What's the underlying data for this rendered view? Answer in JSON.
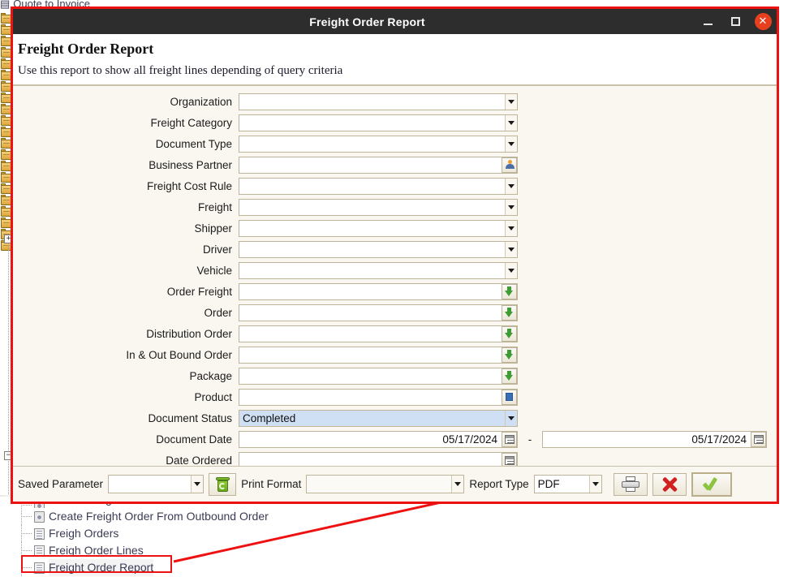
{
  "background": {
    "top_item_label": "Quote to Invoice",
    "tree_items": [
      {
        "label": "Create Freight Order From Order",
        "icon": "gear-icon",
        "selected": false,
        "clipped": true
      },
      {
        "label": "Create Freight Order From Outbound Order",
        "icon": "gear-icon",
        "selected": false,
        "clipped": false
      },
      {
        "label": "Freigh Orders",
        "icon": "document-icon",
        "selected": false,
        "clipped": false
      },
      {
        "label": "Freigh Order Lines",
        "icon": "document-icon",
        "selected": false,
        "clipped": false
      },
      {
        "label": "Freight Order Report",
        "icon": "document-icon",
        "selected": true,
        "clipped": false
      }
    ],
    "expanders": [
      {
        "name": "expander-plus",
        "glyph": "+"
      },
      {
        "name": "expander-minus",
        "glyph": "−"
      }
    ]
  },
  "dialog": {
    "titlebar": {
      "title": "Freight Order Report",
      "minimize_label": "–",
      "maximize_label": "□",
      "close_label": "✕"
    },
    "header": {
      "title": "Freight Order Report",
      "description": "Use this report to show all freight lines depending of query criteria"
    },
    "fields": [
      {
        "label": "Organization",
        "value": "",
        "control": "combo",
        "icon": "chevron-down-icon"
      },
      {
        "label": "Freight Category",
        "value": "",
        "control": "combo",
        "icon": "chevron-down-icon"
      },
      {
        "label": "Document Type",
        "value": "",
        "control": "combo",
        "icon": "chevron-down-icon"
      },
      {
        "label": "Business Partner",
        "value": "",
        "control": "button",
        "icon": "person-icon"
      },
      {
        "label": "Freight Cost Rule",
        "value": "",
        "control": "combo",
        "icon": "chevron-down-icon"
      },
      {
        "label": "Freight",
        "value": "",
        "control": "combo",
        "icon": "chevron-down-icon"
      },
      {
        "label": "Shipper",
        "value": "",
        "control": "combo",
        "icon": "chevron-down-icon"
      },
      {
        "label": "Driver",
        "value": "",
        "control": "combo",
        "icon": "chevron-down-icon"
      },
      {
        "label": "Vehicle",
        "value": "",
        "control": "combo",
        "icon": "chevron-down-icon"
      },
      {
        "label": "Order Freight",
        "value": "",
        "control": "button",
        "icon": "green-down-arrow-icon"
      },
      {
        "label": "Order",
        "value": "",
        "control": "button",
        "icon": "green-down-arrow-icon"
      },
      {
        "label": "Distribution Order",
        "value": "",
        "control": "button",
        "icon": "green-down-arrow-icon"
      },
      {
        "label": "In & Out Bound Order",
        "value": "",
        "control": "button",
        "icon": "green-down-arrow-icon"
      },
      {
        "label": "Package",
        "value": "",
        "control": "button",
        "icon": "green-down-arrow-icon"
      },
      {
        "label": "Product",
        "value": "",
        "control": "button",
        "icon": "blue-box-icon"
      },
      {
        "label": "Document Status",
        "value": "Completed",
        "control": "combo",
        "icon": "chevron-down-icon",
        "highlighted": true
      },
      {
        "label": "Document Date",
        "value": "05/17/2024",
        "control": "daterange",
        "icon": "calendar-icon",
        "range_dash": "-",
        "value2": "05/17/2024"
      },
      {
        "label": "Date Ordered",
        "value": "",
        "control": "date",
        "icon": "calendar-icon"
      }
    ],
    "footer": {
      "saved_parameter_label": "Saved Parameter",
      "saved_parameter_value": "",
      "delete_parameter_icon": "recycle-bin-icon",
      "print_format_label": "Print Format",
      "print_format_value": "",
      "report_type_label": "Report Type",
      "report_type_value": "PDF",
      "print_icon": "printer-icon",
      "cancel_icon": "red-x-icon",
      "ok_icon": "green-check-icon"
    }
  },
  "colors": {
    "dialog_border": "#ee1111",
    "titlebar_bg": "#2d2d2d",
    "close_button": "#e8401f",
    "form_bg": "#faf7f0",
    "field_border": "#bdb49a",
    "highlight_field": "#cfe0f5",
    "accent_green": "#8bc53f",
    "accent_red": "#d02020"
  }
}
